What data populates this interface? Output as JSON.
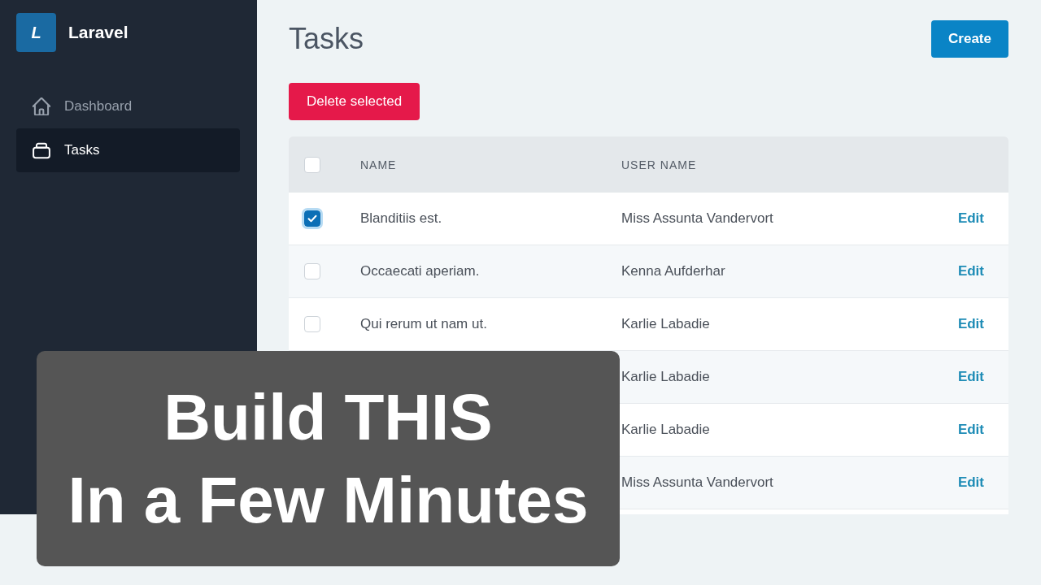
{
  "sidebar": {
    "brand": {
      "logo_letter": "L",
      "name": "Laravel"
    },
    "items": [
      {
        "label": "Dashboard",
        "selected": false
      },
      {
        "label": "Tasks",
        "selected": true
      }
    ]
  },
  "page": {
    "title": "Tasks",
    "create_button": "Create",
    "delete_button": "Delete selected"
  },
  "table": {
    "select_all": {
      "checked": false
    },
    "columns": [
      "NAME",
      "USER NAME"
    ],
    "rows": [
      {
        "checked": true,
        "name": "Blanditiis est.",
        "user_name": "Miss Assunta Vandervort",
        "action": "Edit"
      },
      {
        "checked": false,
        "name": "Occaecati aperiam.",
        "user_name": "Kenna Aufderhar",
        "action": "Edit"
      },
      {
        "checked": false,
        "name": "Qui rerum ut nam ut.",
        "user_name": "Karlie Labadie",
        "action": "Edit"
      },
      {
        "user_name": "Karlie Labadie",
        "action": "Edit"
      },
      {
        "user_name": "Karlie Labadie",
        "action": "Edit"
      },
      {
        "user_name": "Miss Assunta Vandervort",
        "action": "Edit"
      }
    ]
  },
  "banner": {
    "lines": [
      "Build THIS",
      "In a Few Minutes"
    ]
  }
}
